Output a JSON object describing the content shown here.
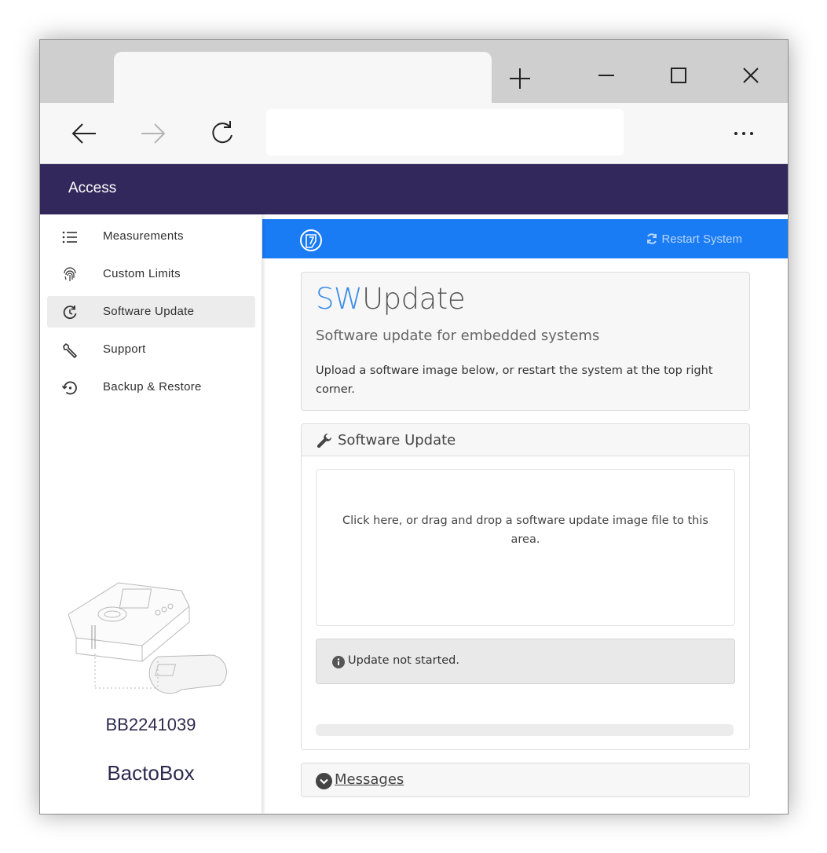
{
  "app": {
    "header_title": "Access"
  },
  "sidebar": {
    "items": [
      {
        "label": "Measurements",
        "icon": "list-icon"
      },
      {
        "label": "Custom Limits",
        "icon": "fingerprint-icon"
      },
      {
        "label": "Software Update",
        "icon": "update-icon",
        "active": true
      },
      {
        "label": "Support",
        "icon": "wrench-icon"
      },
      {
        "label": "Backup & Restore",
        "icon": "restore-icon"
      }
    ],
    "serial": "BB2241039",
    "product": "BactoBox"
  },
  "topbar": {
    "restart_label": "Restart System"
  },
  "jumbotron": {
    "title_accent": "SW",
    "title_rest": "Update",
    "subtitle": "Software update for embedded systems",
    "text": "Upload a software image below, or restart the system at the top right corner."
  },
  "update_panel": {
    "title": "Software Update",
    "dropzone_text": "Click here, or drag and drop a software update image file to this area.",
    "status_text": "Update not started.",
    "progress": 0
  },
  "messages": {
    "label": "Messages"
  },
  "colors": {
    "appbar": "#33285b",
    "accent_blue": "#1a7cf5"
  }
}
